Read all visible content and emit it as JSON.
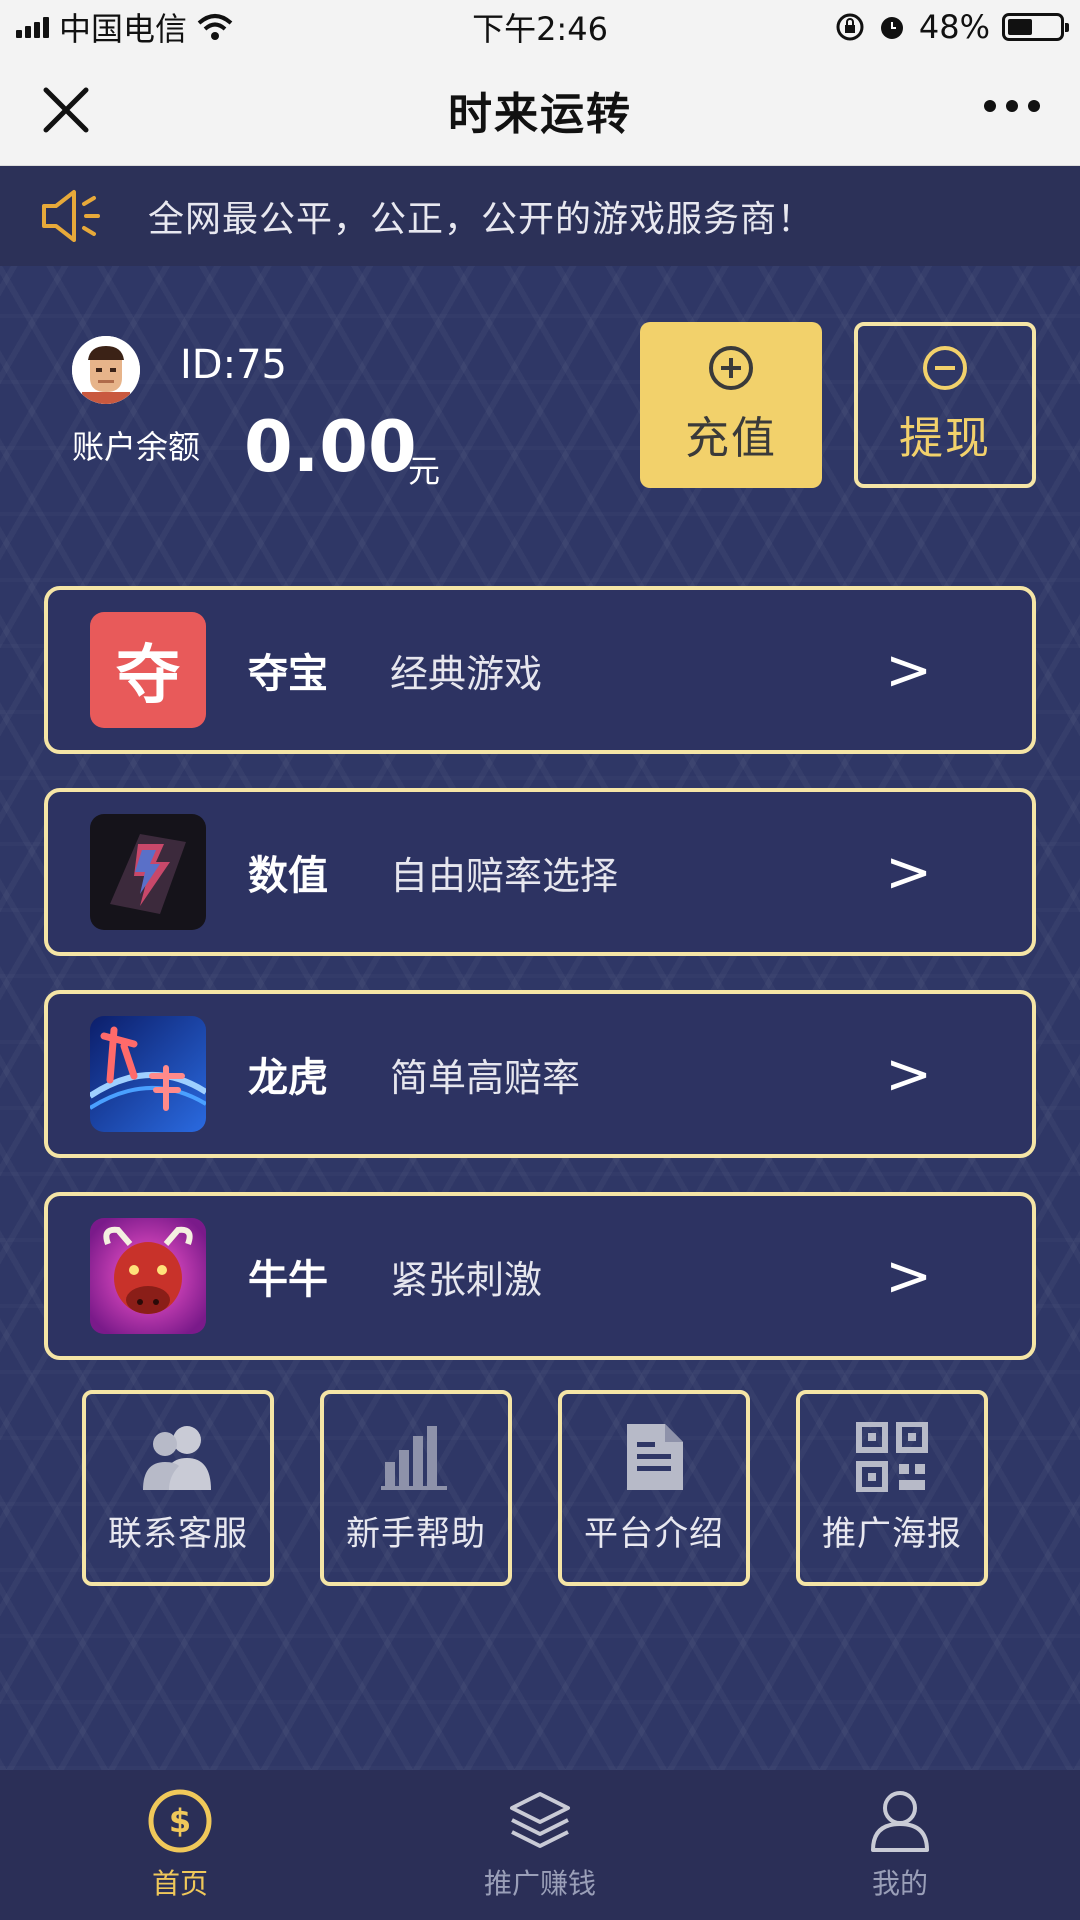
{
  "status_bar": {
    "carrier": "中国电信",
    "time": "下午2:46",
    "battery": "48%",
    "battery_level": 0.48
  },
  "nav": {
    "title": "时来运转",
    "close_icon": "close-icon",
    "more_icon": "more-icon"
  },
  "notice": {
    "text": "全网最公平，公正，公开的游戏服务商！"
  },
  "account": {
    "id_label": "ID:75",
    "balance_label": "账户余额",
    "balance_value": "0.00",
    "balance_unit": "元",
    "recharge_label": "充值",
    "withdraw_label": "提现"
  },
  "games": [
    {
      "name": "夺宝",
      "desc": "经典游戏",
      "arrow": ">"
    },
    {
      "name": "数值",
      "desc": "自由赔率选择",
      "arrow": ">"
    },
    {
      "name": "龙虎",
      "desc": "简单高赔率",
      "arrow": ">"
    },
    {
      "name": "牛牛",
      "desc": "紧张刺激",
      "arrow": ">"
    }
  ],
  "game_icon_text": {
    "duobao": "夺"
  },
  "quick_links": [
    {
      "label": "联系客服",
      "icon": "users-icon"
    },
    {
      "label": "新手帮助",
      "icon": "bar-chart-icon"
    },
    {
      "label": "平台介绍",
      "icon": "document-icon"
    },
    {
      "label": "推广海报",
      "icon": "qr-code-icon"
    }
  ],
  "tabs": [
    {
      "label": "首页",
      "icon": "dollar-icon",
      "active": true
    },
    {
      "label": "推广赚钱",
      "icon": "layers-icon",
      "active": false
    },
    {
      "label": "我的",
      "icon": "user-icon",
      "active": false
    }
  ],
  "colors": {
    "accent": "#f2d16b",
    "border": "#f5e5a6",
    "background": "#2f3766"
  }
}
